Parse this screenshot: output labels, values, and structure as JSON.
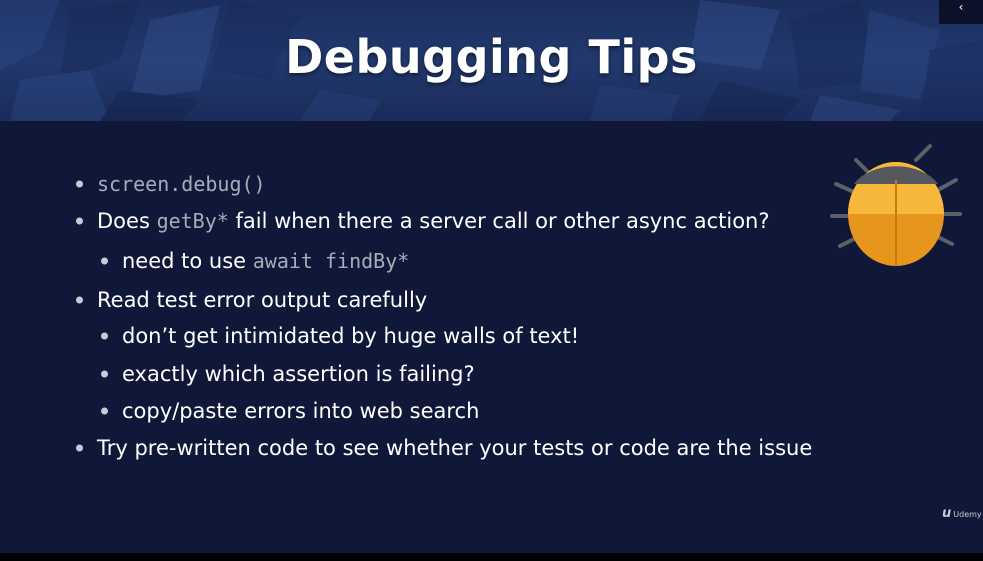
{
  "slide": {
    "title": "Debugging Tips",
    "bullets": [
      {
        "mono": "screen.debug()"
      },
      {
        "pre": "Does ",
        "mono": "getBy*",
        "post": " fail when there a server call or other async action?"
      },
      {
        "pre": "need to use ",
        "mono": "await findBy*"
      },
      {
        "text": "Read test error output carefully"
      },
      {
        "text": "don’t get intimidated by huge walls of text!"
      },
      {
        "text": "exactly which assertion is failing?"
      },
      {
        "text": "copy/paste errors into web search"
      },
      {
        "text": "Try pre-written code to see whether your tests or code are the issue"
      }
    ]
  },
  "icons": {
    "bug": "bug-icon",
    "corner": "chevron-left-icon",
    "logo": "udemy-logo"
  },
  "branding": {
    "logo_mark": "u",
    "logo_text": "Udemy"
  },
  "colors": {
    "background": "#10183a",
    "banner": "#22396e",
    "text": "#ffffff",
    "code": "#a7acb8",
    "bug_body": "#f0a92a",
    "bug_head": "#55585f"
  }
}
